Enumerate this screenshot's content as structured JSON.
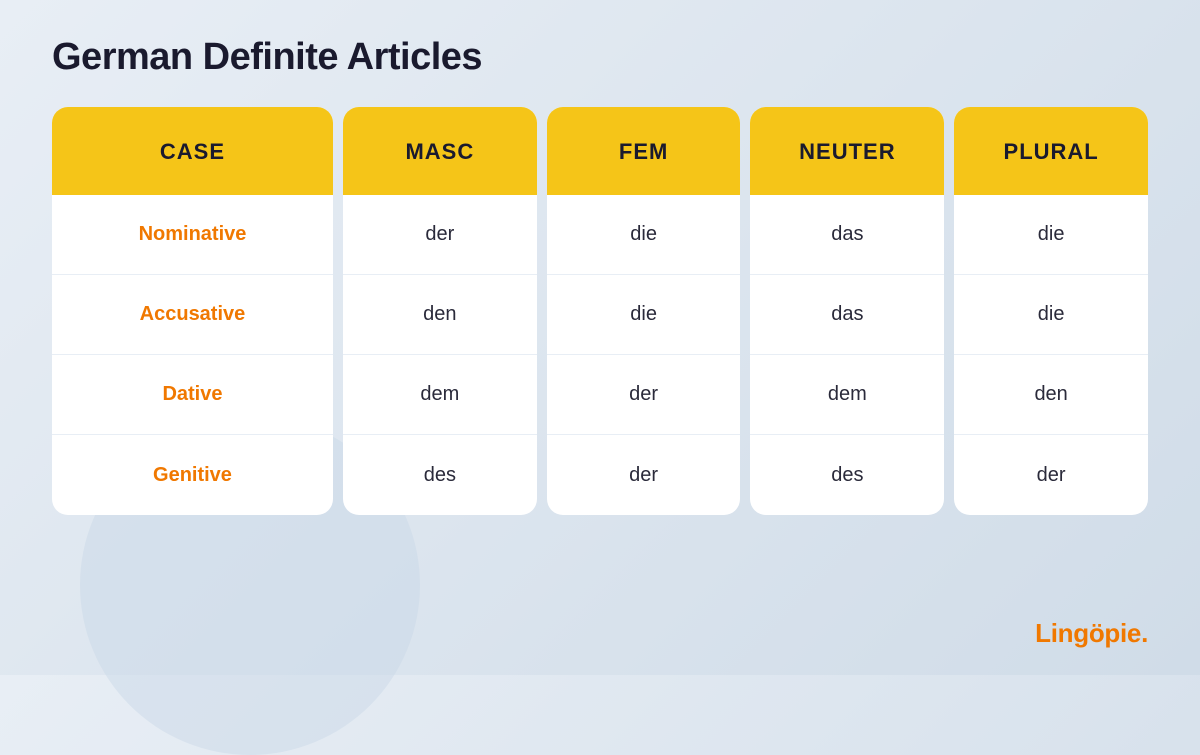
{
  "page": {
    "title": "German Definite Articles",
    "brand": "Lingöpie."
  },
  "columns": [
    {
      "id": "case",
      "header": "CASE",
      "cells": [
        "Nominative",
        "Accusative",
        "Dative",
        "Genitive"
      ]
    },
    {
      "id": "masc",
      "header": "MASC",
      "cells": [
        "der",
        "den",
        "dem",
        "des"
      ]
    },
    {
      "id": "fem",
      "header": "FEM",
      "cells": [
        "die",
        "die",
        "der",
        "der"
      ]
    },
    {
      "id": "neuter",
      "header": "NEUTER",
      "cells": [
        "das",
        "das",
        "dem",
        "des"
      ]
    },
    {
      "id": "plural",
      "header": "PLURAL",
      "cells": [
        "die",
        "die",
        "den",
        "der"
      ]
    }
  ]
}
